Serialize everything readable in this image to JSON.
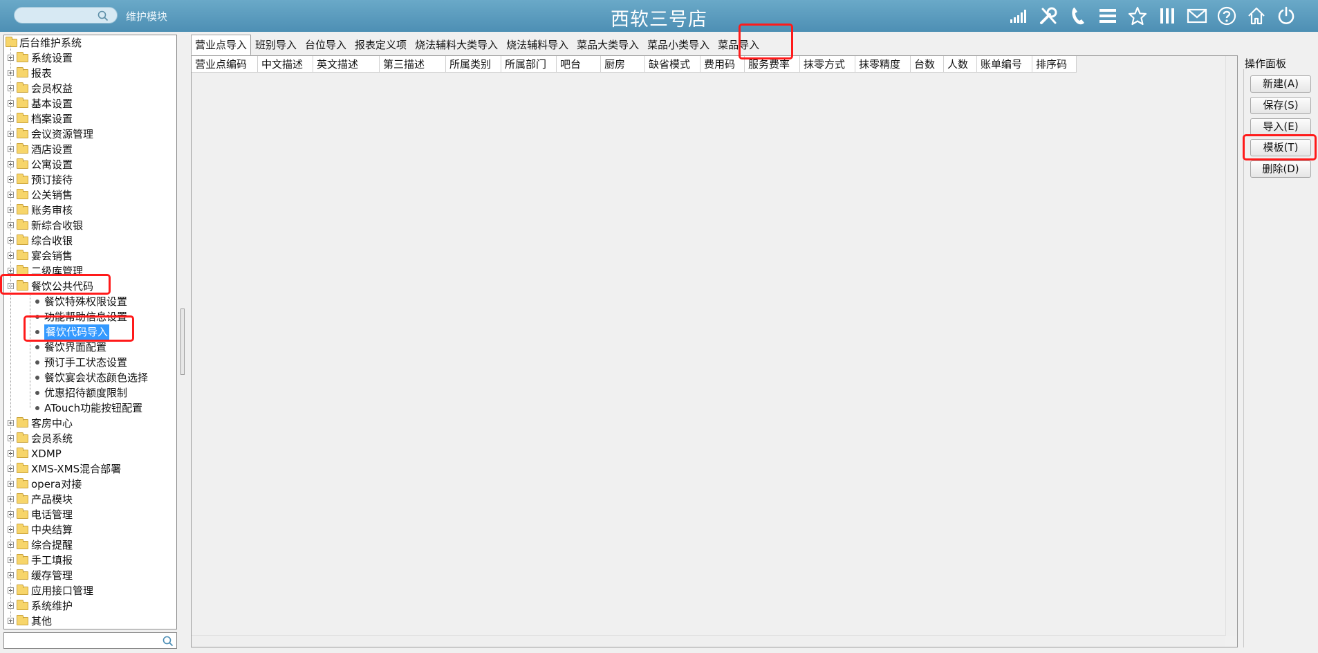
{
  "header": {
    "search_placeholder": "",
    "module_label": "维护模块",
    "store_title": "西软三号店",
    "icons": [
      "signal-icon",
      "tools-icon",
      "phone-icon",
      "menu-icon",
      "star-icon",
      "columns-icon",
      "mail-icon",
      "help-icon",
      "home-icon",
      "power-icon"
    ]
  },
  "tree": {
    "root": "后台维护系统",
    "items": [
      "系统设置",
      "报表",
      "会员权益",
      "基本设置",
      "档案设置",
      "会议资源管理",
      "酒店设置",
      "公寓设置",
      "预订接待",
      "公关销售",
      "账务审核",
      "新综合收银",
      "综合收银",
      "宴会销售",
      "二级库管理",
      "餐饮公共代码"
    ],
    "children": [
      "餐饮特殊权限设置",
      "功能帮助信息设置",
      "餐饮代码导入",
      "餐饮界面配置",
      "预订手工状态设置",
      "餐饮宴会状态颜色选择",
      "优惠招待额度限制",
      "ATouch功能按钮配置"
    ],
    "selected_child": "餐饮代码导入",
    "items_after": [
      "客房中心",
      "会员系统",
      "XDMP",
      "XMS-XMS混合部署",
      "opera对接",
      "产品模块",
      "电话管理",
      "中央结算",
      "综合提醒",
      "手工填报",
      "缓存管理",
      "应用接口管理",
      "系统维护",
      "其他"
    ],
    "search_value": ""
  },
  "tabs": [
    "营业点导入",
    "班别导入",
    "台位导入",
    "报表定义项",
    "烧法辅料大类导入",
    "烧法辅料导入",
    "菜品大类导入",
    "菜品小类导入",
    "菜品导入"
  ],
  "active_tab": "营业点导入",
  "grid": {
    "columns": [
      "营业点编码",
      "中文描述",
      "英文描述",
      "第三描述",
      "所属类别",
      "所属部门",
      "吧台",
      "厨房",
      "缺省模式",
      "费用码",
      "服务费率",
      "抹零方式",
      "抹零精度",
      "台数",
      "人数",
      "账单编号",
      "排序码"
    ]
  },
  "ops": {
    "title": "操作面板",
    "buttons": [
      "新建(A)",
      "保存(S)",
      "导入(E)",
      "模板(T)",
      "删除(D)"
    ]
  },
  "colors": {
    "header_bg": "#5b9cc0",
    "highlight": "#ff1a1a",
    "selected_bg": "#3399ff",
    "folder": "#f7d56a"
  }
}
